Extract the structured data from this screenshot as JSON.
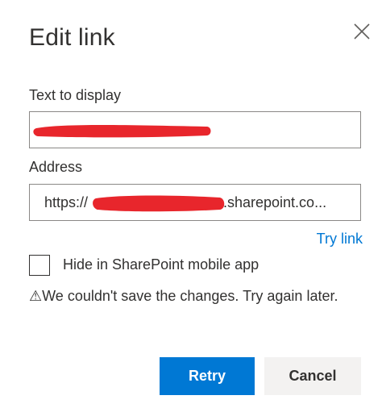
{
  "dialog": {
    "title": "Edit link",
    "close_icon": "close-icon",
    "text_label": "Text to display",
    "address_label": "Address",
    "address_prefix": "https://",
    "address_suffix": ".sharepoint.co...",
    "try_link": "Try link",
    "hide_checkbox_label": "Hide in SharePoint mobile app",
    "hide_checkbox_checked": false,
    "error_icon": "warning-icon",
    "error_glyph": "⚠",
    "error_text": "We couldn't save the changes. Try again later.",
    "retry_label": "Retry",
    "cancel_label": "Cancel"
  },
  "colors": {
    "accent": "#0078d4",
    "redaction": "#e8262c",
    "text": "#323130"
  }
}
